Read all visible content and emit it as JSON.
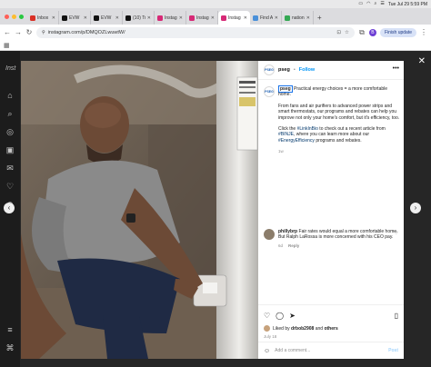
{
  "menubar": {
    "datetime": "Tue Jul 29  5:59 PM"
  },
  "browser": {
    "tabs": [
      {
        "label": "Inbox",
        "fav_color": "#d93025",
        "active": false
      },
      {
        "label": "EVW",
        "fav_color": "#111111",
        "active": false
      },
      {
        "label": "EVW",
        "fav_color": "#111111",
        "active": false
      },
      {
        "label": "(10) Tr",
        "fav_color": "#111111",
        "active": false
      },
      {
        "label": "Instag",
        "fav_color": "#d62976",
        "active": false
      },
      {
        "label": "Instag",
        "fav_color": "#d62976",
        "active": false
      },
      {
        "label": "Instag",
        "fav_color": "#d62976",
        "active": true
      },
      {
        "label": "Find A",
        "fav_color": "#4a90d9",
        "active": false
      },
      {
        "label": "nation",
        "fav_color": "#34a853",
        "active": false
      }
    ],
    "url": "instagram.com/p/DMQOZLwuwtW/",
    "profile_initial": "B",
    "finish_update_label": "Finish update"
  },
  "post": {
    "username": "pseg",
    "separator": "•",
    "follow_label": "Follow",
    "avatar_text": "PSEG",
    "caption": {
      "username": "pseg",
      "line1": " Practical energy choices = a more comfortable home. ",
      "paragraph2": "From fans and air purifiers to advanced power strips and smart thermostats, our programs and rebates can help you improve not only your home's comfort, but it's efficiency, too.",
      "p3_a": "Click the ",
      "p3_tag1": "#LinkInBio",
      "p3_b": " to check out a recent article from ",
      "p3_tag2": "#BINJE",
      "p3_c": ", where you can learn more about our ",
      "p3_tag3": "#EnergyEfficiency",
      "p3_d": " programs and rebates.",
      "age": "1w"
    },
    "comment": {
      "username": "phillybrp",
      "text": " Fair rates would equal a more comfortable home. But Ralph LaRossa is more concerned with his CEO pay.",
      "age": "6d",
      "reply_label": "Reply"
    },
    "likes": {
      "prefix": "Liked by ",
      "user": "drbob2908",
      "conj": " and ",
      "others": "others"
    },
    "date": "July 18",
    "add_comment_placeholder": "Add a comment...",
    "post_label": "Post"
  },
  "icons": {
    "heart": "♡",
    "comment": "◯",
    "share": "➤",
    "save": "▯",
    "more": "•••",
    "close": "✕",
    "prev": "‹",
    "next": "›",
    "emoji": "☺"
  },
  "sidebar_logo": "Inst"
}
